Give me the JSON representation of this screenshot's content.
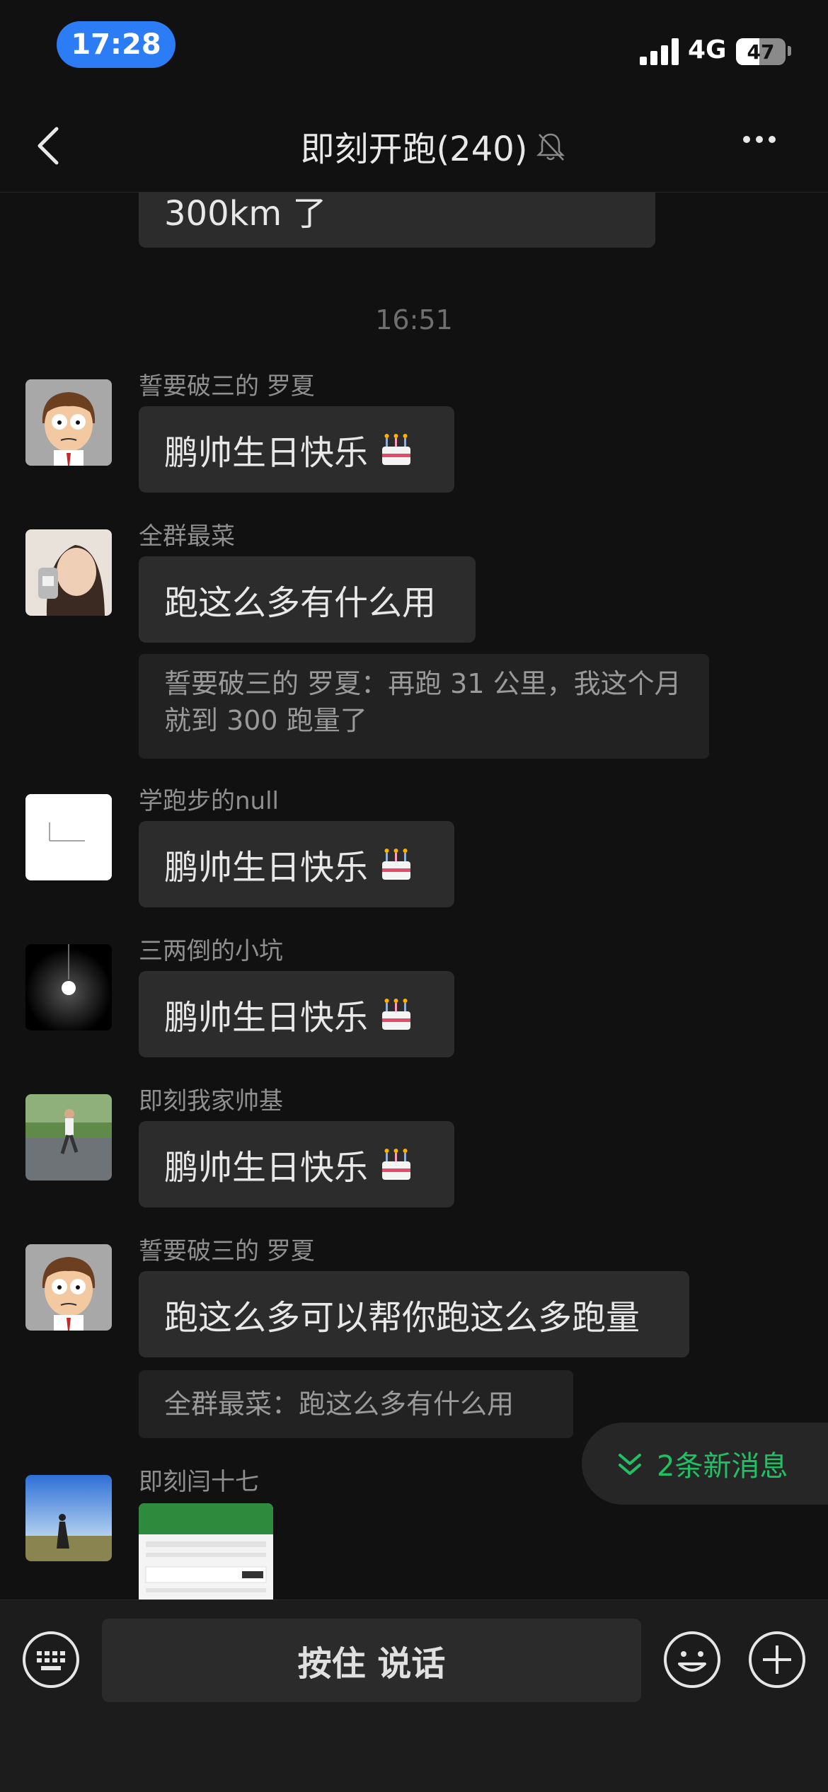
{
  "status_bar": {
    "time": "17:28",
    "network": "4G",
    "battery": "47",
    "battery_level": 0.47
  },
  "header": {
    "title": "即刻开跑(240)"
  },
  "chat": {
    "partial_bubble": "300km 了",
    "time_separator": "16:51",
    "messages": [
      {
        "sender": "誓要破三的 罗夏",
        "text": "鹏帅生日快乐"
      },
      {
        "sender": "全群最菜",
        "text": "跑这么多有什么用",
        "quote": "誓要破三的 罗夏：再跑 31 公里，我这个月就到 300 跑量了"
      },
      {
        "sender": "学跑步的null",
        "text": "鹏帅生日快乐"
      },
      {
        "sender": "三两倒的小坑",
        "text": "鹏帅生日快乐"
      },
      {
        "sender": "即刻我家帅基",
        "text": "鹏帅生日快乐"
      },
      {
        "sender": "誓要破三的 罗夏",
        "text": "跑这么多可以帮你跑这么多跑量",
        "quote": "全群最菜：跑这么多有什么用"
      },
      {
        "sender": "即刻闫十七"
      }
    ],
    "new_messages": "2条新消息"
  },
  "bottom_bar": {
    "talk_label": "按住 说话"
  },
  "colors": {
    "accent_green": "#22c064",
    "time_pill": "#2c7cf6",
    "bubble": "#2c2c2c",
    "background": "#111111"
  }
}
